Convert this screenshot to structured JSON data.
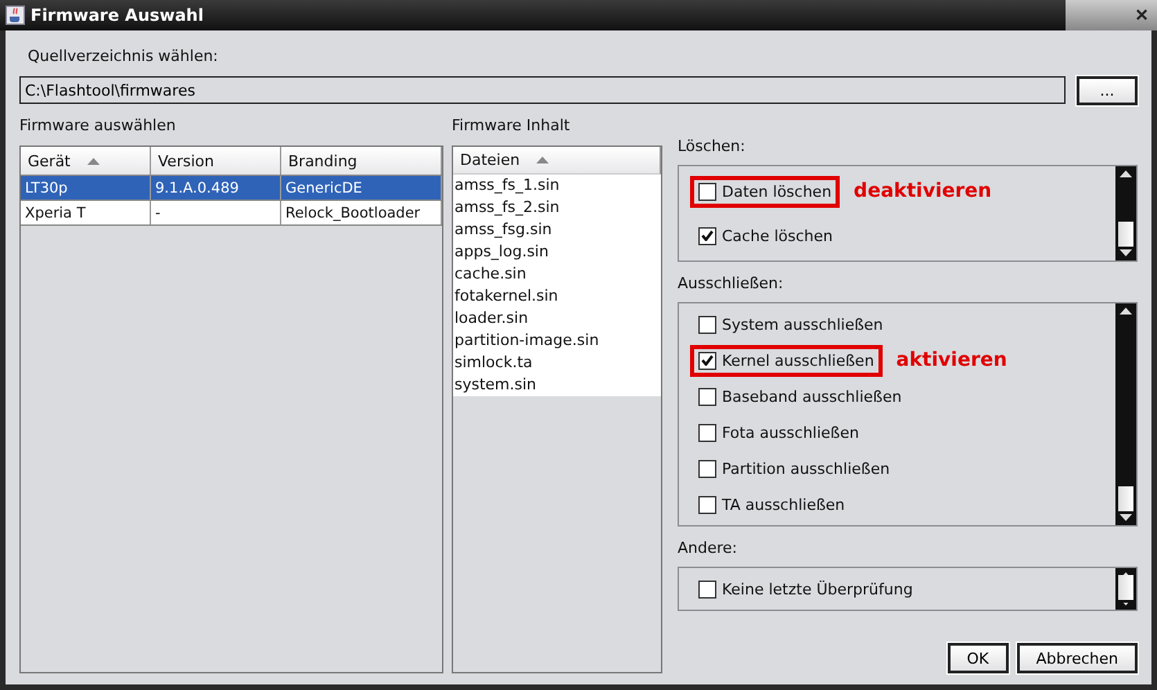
{
  "window": {
    "title": "Firmware Auswahl",
    "close": "✕"
  },
  "source": {
    "label": "Quellverzeichnis wählen:",
    "path": "C:\\Flashtool\\firmwares",
    "browse": "..."
  },
  "firmware": {
    "label": "Firmware auswählen",
    "columns": [
      {
        "label": "Gerät",
        "sorted": true
      },
      {
        "label": "Version",
        "sorted": false
      },
      {
        "label": "Branding",
        "sorted": false
      }
    ],
    "rows": [
      {
        "cells": [
          "LT30p",
          "9.1.A.0.489",
          "GenericDE"
        ],
        "selected": true
      },
      {
        "cells": [
          "Xperia T",
          "-",
          "Relock_Bootloader"
        ],
        "selected": false
      }
    ]
  },
  "content": {
    "label": "Firmware Inhalt",
    "column": {
      "label": "Dateien",
      "sorted": true
    },
    "files": [
      "amss_fs_1.sin",
      "amss_fs_2.sin",
      "amss_fsg.sin",
      "apps_log.sin",
      "cache.sin",
      "fotakernel.sin",
      "loader.sin",
      "partition-image.sin",
      "simlock.ta",
      "system.sin"
    ]
  },
  "groups": [
    {
      "label": "Löschen:",
      "items": [
        {
          "label": "Daten löschen",
          "checked": false,
          "highlighted": true,
          "annotation": "deaktivieren"
        },
        {
          "label": "Cache löschen",
          "checked": true,
          "highlighted": false
        }
      ]
    },
    {
      "label": "Ausschließen:",
      "items": [
        {
          "label": "System ausschließen",
          "checked": false,
          "highlighted": false
        },
        {
          "label": "Kernel ausschließen",
          "checked": true,
          "highlighted": true,
          "annotation": "aktivieren"
        },
        {
          "label": "Baseband ausschließen",
          "checked": false,
          "highlighted": false
        },
        {
          "label": "Fota ausschließen",
          "checked": false,
          "highlighted": false
        },
        {
          "label": "Partition ausschließen",
          "checked": false,
          "highlighted": false
        },
        {
          "label": "TA ausschließen",
          "checked": false,
          "highlighted": false
        }
      ]
    },
    {
      "label": "Andere:",
      "items": [
        {
          "label": "Keine letzte Überprüfung",
          "checked": false,
          "highlighted": false
        }
      ]
    }
  ],
  "buttons": [
    "OK",
    "Abbrechen"
  ]
}
